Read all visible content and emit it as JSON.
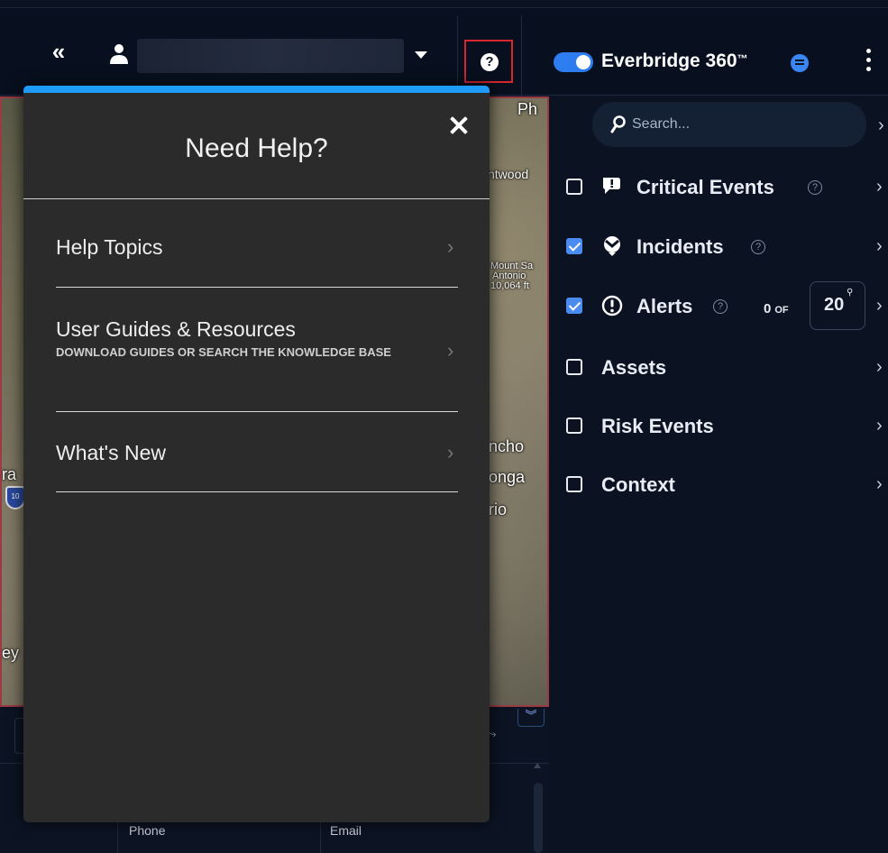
{
  "topbar": {
    "collapse_glyph": "«",
    "brand_name": "Everbridge 360",
    "brand_tm": "™"
  },
  "map": {
    "labels": [
      "Ph",
      "ntwood",
      "Mount Sa",
      "Antonio",
      "10,064 ft",
      "ncho",
      "onga",
      "rio",
      "ra",
      "ey"
    ],
    "highway_shield": "10"
  },
  "layers_panel": {
    "expand_glyph": "»",
    "search_placeholder": "Search...",
    "layers": [
      {
        "label": "Critical Events",
        "checked": false,
        "icon": "chat-alert-icon"
      },
      {
        "label": "Incidents",
        "checked": true,
        "icon": "incident-icon"
      },
      {
        "label": "Alerts",
        "checked": true,
        "icon": "exclamation-circle-icon"
      },
      {
        "label": "Assets",
        "checked": false
      },
      {
        "label": "Risk Events",
        "checked": false
      },
      {
        "label": "Context",
        "checked": false
      }
    ],
    "alerts_count": "0",
    "alerts_of": "OF",
    "alerts_limit": "20"
  },
  "bottom_table": {
    "columns": [
      "Phone",
      "Email"
    ]
  },
  "help_modal": {
    "title": "Need Help?",
    "items": [
      {
        "label": "Help Topics",
        "subtitle": ""
      },
      {
        "label": "User Guides & Resources",
        "subtitle": "DOWNLOAD GUIDES OR SEARCH THE KNOWLEDGE BASE"
      },
      {
        "label": "What's New",
        "subtitle": ""
      }
    ]
  },
  "colors": {
    "accent_blue": "#1e9af7",
    "toggle_blue": "#2d7cf0",
    "help_highlight": "#d8262f",
    "modal_bg": "#2b2b2b",
    "app_bg": "#0b1322"
  }
}
